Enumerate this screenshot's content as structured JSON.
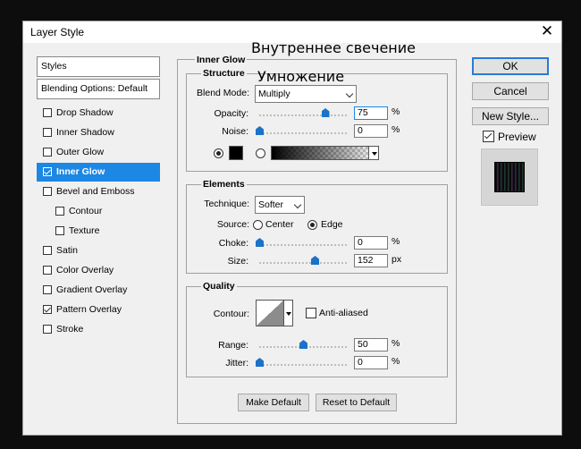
{
  "window": {
    "title": "Layer Style"
  },
  "overlay": {
    "caption1": "Внутреннее свечение",
    "caption2": "Умножение"
  },
  "sidebar": {
    "styles_header": "Styles",
    "blending_options": "Blending Options: Default",
    "items": [
      {
        "label": "Drop Shadow",
        "checked": false
      },
      {
        "label": "Inner Shadow",
        "checked": false
      },
      {
        "label": "Outer Glow",
        "checked": false
      },
      {
        "label": "Inner Glow",
        "checked": true,
        "selected": true
      },
      {
        "label": "Bevel and Emboss",
        "checked": false
      },
      {
        "label": "Contour",
        "checked": false,
        "indent": true
      },
      {
        "label": "Texture",
        "checked": false,
        "indent": true
      },
      {
        "label": "Satin",
        "checked": false
      },
      {
        "label": "Color Overlay",
        "checked": false
      },
      {
        "label": "Gradient Overlay",
        "checked": false
      },
      {
        "label": "Pattern Overlay",
        "checked": true
      },
      {
        "label": "Stroke",
        "checked": false
      }
    ]
  },
  "panel": {
    "title": "Inner Glow",
    "structure": {
      "title": "Structure",
      "blend_mode_label": "Blend Mode:",
      "blend_mode_value": "Multiply",
      "opacity_label": "Opacity:",
      "opacity_value": "75",
      "opacity_level": 75,
      "noise_label": "Noise:",
      "noise_value": "0",
      "noise_level": 0,
      "unit_percent": "%",
      "glow_color": "#000000"
    },
    "elements": {
      "title": "Elements",
      "technique_label": "Technique:",
      "technique_value": "Softer",
      "source_label": "Source:",
      "source_center": "Center",
      "source_edge": "Edge",
      "choke_label": "Choke:",
      "choke_value": "0",
      "choke_level": 0,
      "size_label": "Size:",
      "size_value": "152",
      "size_unit": "px",
      "unit_percent": "%"
    },
    "quality": {
      "title": "Quality",
      "contour_label": "Contour:",
      "anti_aliased_label": "Anti-aliased",
      "range_label": "Range:",
      "range_value": "50",
      "range_level": 50,
      "jitter_label": "Jitter:",
      "jitter_value": "0",
      "jitter_level": 0,
      "unit_percent": "%"
    },
    "make_default": "Make Default",
    "reset_default": "Reset to Default"
  },
  "actions": {
    "ok": "OK",
    "cancel": "Cancel",
    "new_style": "New Style...",
    "preview_label": "Preview",
    "preview_checked": true
  },
  "colors": {
    "accent": "#1d87e4",
    "slider_thumb": "#1a73c9"
  }
}
